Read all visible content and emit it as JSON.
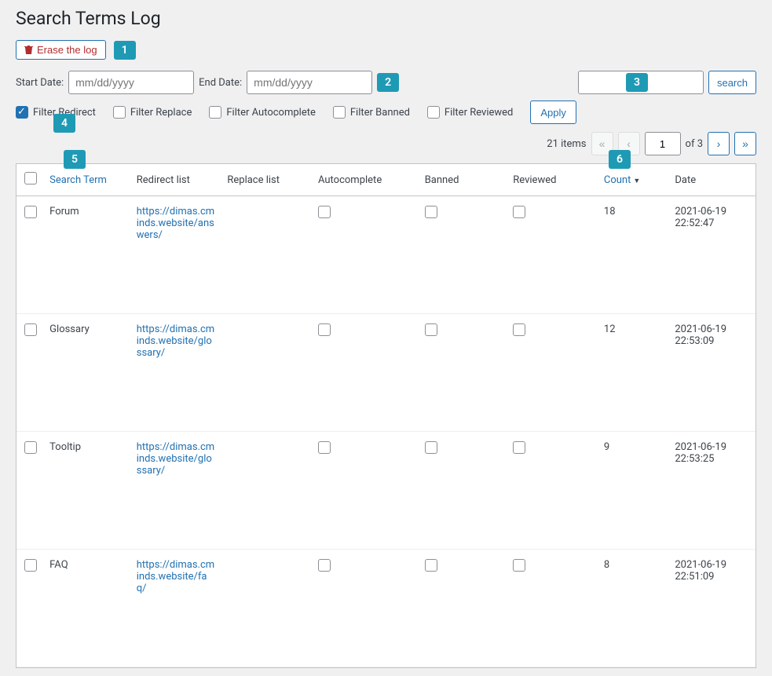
{
  "page_title": "Search Terms Log",
  "erase_button": "Erase the log",
  "badges": {
    "b1": "1",
    "b2": "2",
    "b3": "3",
    "b4": "4",
    "b5": "5",
    "b6": "6"
  },
  "date_filters": {
    "start_label": "Start Date:",
    "start_placeholder": "mm/dd/yyyy",
    "end_label": "End Date:",
    "end_placeholder": "mm/dd/yyyy"
  },
  "search": {
    "button": "search"
  },
  "checkbox_filters": {
    "redirect": "Filter Redirect",
    "replace": "Filter Replace",
    "autocomplete": "Filter Autocomplete",
    "banned": "Filter Banned",
    "reviewed": "Filter Reviewed",
    "apply": "Apply"
  },
  "pagination": {
    "items_text": "21 items",
    "current": "1",
    "of_text": "of 3"
  },
  "table": {
    "headers": {
      "search_term": "Search Term",
      "redirect": "Redirect list",
      "replace": "Replace list",
      "autocomplete": "Autocomplete",
      "banned": "Banned",
      "reviewed": "Reviewed",
      "count": "Count",
      "date": "Date"
    },
    "rows": [
      {
        "term": "Forum",
        "redirect": "https://dimas.cminds.website/answers/",
        "count": "18",
        "date": "2021-06-19 22:52:47"
      },
      {
        "term": "Glossary",
        "redirect": "https://dimas.cminds.website/glossary/",
        "count": "12",
        "date": "2021-06-19 22:53:09"
      },
      {
        "term": "Tooltip",
        "redirect": "https://dimas.cminds.website/glossary/",
        "count": "9",
        "date": "2021-06-19 22:53:25"
      },
      {
        "term": "FAQ",
        "redirect": "https://dimas.cminds.website/faq/",
        "count": "8",
        "date": "2021-06-19 22:51:09"
      }
    ]
  }
}
